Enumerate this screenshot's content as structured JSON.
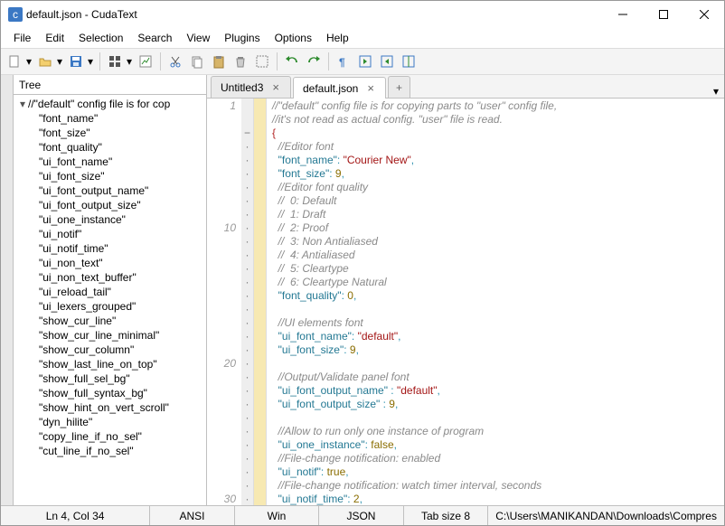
{
  "title": "default.json - CudaText",
  "menu": [
    "File",
    "Edit",
    "Selection",
    "Search",
    "View",
    "Plugins",
    "Options",
    "Help"
  ],
  "tree_header": "Tree",
  "tree_root": "//\"default\" config file is for cop",
  "tree_items": [
    "\"font_name\"",
    "\"font_size\"",
    "\"font_quality\"",
    "\"ui_font_name\"",
    "\"ui_font_size\"",
    "\"ui_font_output_name\"",
    "\"ui_font_output_size\"",
    "\"ui_one_instance\"",
    "\"ui_notif\"",
    "\"ui_notif_time\"",
    "\"ui_non_text\"",
    "\"ui_non_text_buffer\"",
    "\"ui_reload_tail\"",
    "\"ui_lexers_grouped\"",
    "\"show_cur_line\"",
    "\"show_cur_line_minimal\"",
    "\"show_cur_column\"",
    "\"show_last_line_on_top\"",
    "\"show_full_sel_bg\"",
    "\"show_full_syntax_bg\"",
    "\"show_hint_on_vert_scroll\"",
    "\"dyn_hilite\"",
    "\"copy_line_if_no_sel\"",
    "\"cut_line_if_no_sel\""
  ],
  "tabs": [
    {
      "label": "Untitled3",
      "active": false
    },
    {
      "label": "default.json",
      "active": true
    }
  ],
  "line_numbers": [
    "1",
    "",
    "",
    "",
    "",
    "",
    "",
    "",
    "",
    "10",
    "",
    "",
    "",
    "",
    "",
    "",
    "",
    "",
    "",
    "20",
    "",
    "",
    "",
    "",
    "",
    "",
    "",
    "",
    "",
    "30",
    ""
  ],
  "code": [
    {
      "t": "cm",
      "v": "//\"default\" config file is for copying parts to \"user\" config file,"
    },
    {
      "t": "cm",
      "v": "//it's not read as actual config. \"user\" file is read."
    },
    {
      "t": "br",
      "v": "{"
    },
    {
      "t": "cm2",
      "v": "  //Editor font"
    },
    {
      "t": "kv",
      "k": "\"font_name\"",
      "s": ": ",
      "vs": "\"Courier New\"",
      "p": ","
    },
    {
      "t": "kvn",
      "k": "\"font_size\"",
      "s": ": ",
      "vn": "9",
      "p": ","
    },
    {
      "t": "cm2",
      "v": "  //Editor font quality"
    },
    {
      "t": "cm2",
      "v": "  //  0: Default"
    },
    {
      "t": "cm2",
      "v": "  //  1: Draft"
    },
    {
      "t": "cm2",
      "v": "  //  2: Proof"
    },
    {
      "t": "cm2",
      "v": "  //  3: Non Antialiased"
    },
    {
      "t": "cm2",
      "v": "  //  4: Antialiased"
    },
    {
      "t": "cm2",
      "v": "  //  5: Cleartype"
    },
    {
      "t": "cm2",
      "v": "  //  6: Cleartype Natural"
    },
    {
      "t": "kvn",
      "k": "\"font_quality\"",
      "s": ": ",
      "vn": "0",
      "p": ","
    },
    {
      "t": "blank",
      "v": ""
    },
    {
      "t": "cm2",
      "v": "  //UI elements font"
    },
    {
      "t": "kv",
      "k": "\"ui_font_name\"",
      "s": ": ",
      "vs": "\"default\"",
      "p": ","
    },
    {
      "t": "kvn",
      "k": "\"ui_font_size\"",
      "s": ": ",
      "vn": "9",
      "p": ","
    },
    {
      "t": "blank",
      "v": ""
    },
    {
      "t": "cm2",
      "v": "  //Output/Validate panel font"
    },
    {
      "t": "kv",
      "k": "\"ui_font_output_name\"",
      "s": " : ",
      "vs": "\"default\"",
      "p": ","
    },
    {
      "t": "kvn",
      "k": "\"ui_font_output_size\"",
      "s": " : ",
      "vn": "9",
      "p": ","
    },
    {
      "t": "blank",
      "v": ""
    },
    {
      "t": "cm2",
      "v": "  //Allow to run only one instance of program"
    },
    {
      "t": "kvb",
      "k": "\"ui_one_instance\"",
      "s": ": ",
      "vb": "false",
      "p": ","
    },
    {
      "t": "cm2",
      "v": "  //File-change notification: enabled"
    },
    {
      "t": "kvb",
      "k": "\"ui_notif\"",
      "s": ": ",
      "vb": "true",
      "p": ","
    },
    {
      "t": "cm2",
      "v": "  //File-change notification: watch timer interval, seconds"
    },
    {
      "t": "kvn",
      "k": "\"ui_notif_time\"",
      "s": ": ",
      "vn": "2",
      "p": ","
    }
  ],
  "status": {
    "pos": "Ln 4, Col 34",
    "enc": "ANSI",
    "ends": "Win",
    "lexer": "JSON",
    "tab": "Tab size 8",
    "msg": "C:\\Users\\MANIKANDAN\\Downloads\\Compres"
  },
  "icons": {
    "folder_open": "#e6b84f",
    "save": "#3b78c4",
    "undo": "#2e8b2e",
    "redo": "#2e8b2e"
  }
}
